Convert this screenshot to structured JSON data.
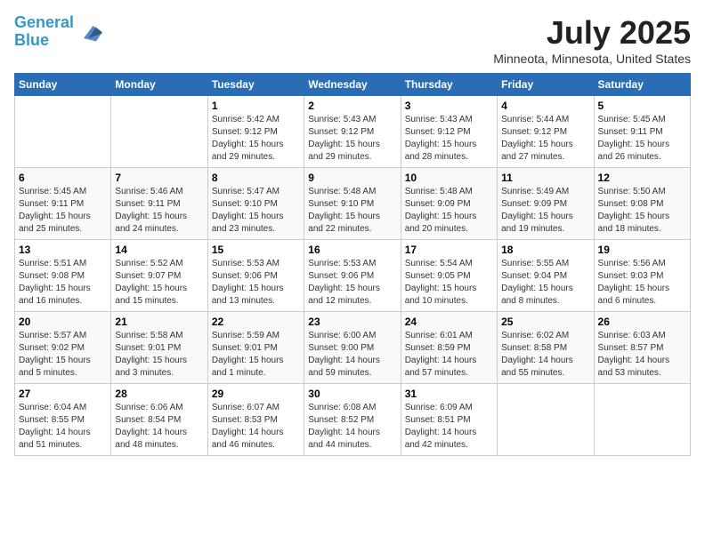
{
  "header": {
    "logo_line1": "General",
    "logo_line2": "Blue",
    "month_title": "July 2025",
    "location": "Minneota, Minnesota, United States"
  },
  "weekdays": [
    "Sunday",
    "Monday",
    "Tuesday",
    "Wednesday",
    "Thursday",
    "Friday",
    "Saturday"
  ],
  "weeks": [
    [
      null,
      null,
      {
        "day": 1,
        "sunrise": "5:42 AM",
        "sunset": "9:12 PM",
        "daylight": "15 hours and 29 minutes."
      },
      {
        "day": 2,
        "sunrise": "5:43 AM",
        "sunset": "9:12 PM",
        "daylight": "15 hours and 29 minutes."
      },
      {
        "day": 3,
        "sunrise": "5:43 AM",
        "sunset": "9:12 PM",
        "daylight": "15 hours and 28 minutes."
      },
      {
        "day": 4,
        "sunrise": "5:44 AM",
        "sunset": "9:12 PM",
        "daylight": "15 hours and 27 minutes."
      },
      {
        "day": 5,
        "sunrise": "5:45 AM",
        "sunset": "9:11 PM",
        "daylight": "15 hours and 26 minutes."
      }
    ],
    [
      {
        "day": 6,
        "sunrise": "5:45 AM",
        "sunset": "9:11 PM",
        "daylight": "15 hours and 25 minutes."
      },
      {
        "day": 7,
        "sunrise": "5:46 AM",
        "sunset": "9:11 PM",
        "daylight": "15 hours and 24 minutes."
      },
      {
        "day": 8,
        "sunrise": "5:47 AM",
        "sunset": "9:10 PM",
        "daylight": "15 hours and 23 minutes."
      },
      {
        "day": 9,
        "sunrise": "5:48 AM",
        "sunset": "9:10 PM",
        "daylight": "15 hours and 22 minutes."
      },
      {
        "day": 10,
        "sunrise": "5:48 AM",
        "sunset": "9:09 PM",
        "daylight": "15 hours and 20 minutes."
      },
      {
        "day": 11,
        "sunrise": "5:49 AM",
        "sunset": "9:09 PM",
        "daylight": "15 hours and 19 minutes."
      },
      {
        "day": 12,
        "sunrise": "5:50 AM",
        "sunset": "9:08 PM",
        "daylight": "15 hours and 18 minutes."
      }
    ],
    [
      {
        "day": 13,
        "sunrise": "5:51 AM",
        "sunset": "9:08 PM",
        "daylight": "15 hours and 16 minutes."
      },
      {
        "day": 14,
        "sunrise": "5:52 AM",
        "sunset": "9:07 PM",
        "daylight": "15 hours and 15 minutes."
      },
      {
        "day": 15,
        "sunrise": "5:53 AM",
        "sunset": "9:06 PM",
        "daylight": "15 hours and 13 minutes."
      },
      {
        "day": 16,
        "sunrise": "5:53 AM",
        "sunset": "9:06 PM",
        "daylight": "15 hours and 12 minutes."
      },
      {
        "day": 17,
        "sunrise": "5:54 AM",
        "sunset": "9:05 PM",
        "daylight": "15 hours and 10 minutes."
      },
      {
        "day": 18,
        "sunrise": "5:55 AM",
        "sunset": "9:04 PM",
        "daylight": "15 hours and 8 minutes."
      },
      {
        "day": 19,
        "sunrise": "5:56 AM",
        "sunset": "9:03 PM",
        "daylight": "15 hours and 6 minutes."
      }
    ],
    [
      {
        "day": 20,
        "sunrise": "5:57 AM",
        "sunset": "9:02 PM",
        "daylight": "15 hours and 5 minutes."
      },
      {
        "day": 21,
        "sunrise": "5:58 AM",
        "sunset": "9:01 PM",
        "daylight": "15 hours and 3 minutes."
      },
      {
        "day": 22,
        "sunrise": "5:59 AM",
        "sunset": "9:01 PM",
        "daylight": "15 hours and 1 minute."
      },
      {
        "day": 23,
        "sunrise": "6:00 AM",
        "sunset": "9:00 PM",
        "daylight": "14 hours and 59 minutes."
      },
      {
        "day": 24,
        "sunrise": "6:01 AM",
        "sunset": "8:59 PM",
        "daylight": "14 hours and 57 minutes."
      },
      {
        "day": 25,
        "sunrise": "6:02 AM",
        "sunset": "8:58 PM",
        "daylight": "14 hours and 55 minutes."
      },
      {
        "day": 26,
        "sunrise": "6:03 AM",
        "sunset": "8:57 PM",
        "daylight": "14 hours and 53 minutes."
      }
    ],
    [
      {
        "day": 27,
        "sunrise": "6:04 AM",
        "sunset": "8:55 PM",
        "daylight": "14 hours and 51 minutes."
      },
      {
        "day": 28,
        "sunrise": "6:06 AM",
        "sunset": "8:54 PM",
        "daylight": "14 hours and 48 minutes."
      },
      {
        "day": 29,
        "sunrise": "6:07 AM",
        "sunset": "8:53 PM",
        "daylight": "14 hours and 46 minutes."
      },
      {
        "day": 30,
        "sunrise": "6:08 AM",
        "sunset": "8:52 PM",
        "daylight": "14 hours and 44 minutes."
      },
      {
        "day": 31,
        "sunrise": "6:09 AM",
        "sunset": "8:51 PM",
        "daylight": "14 hours and 42 minutes."
      },
      null,
      null
    ]
  ]
}
